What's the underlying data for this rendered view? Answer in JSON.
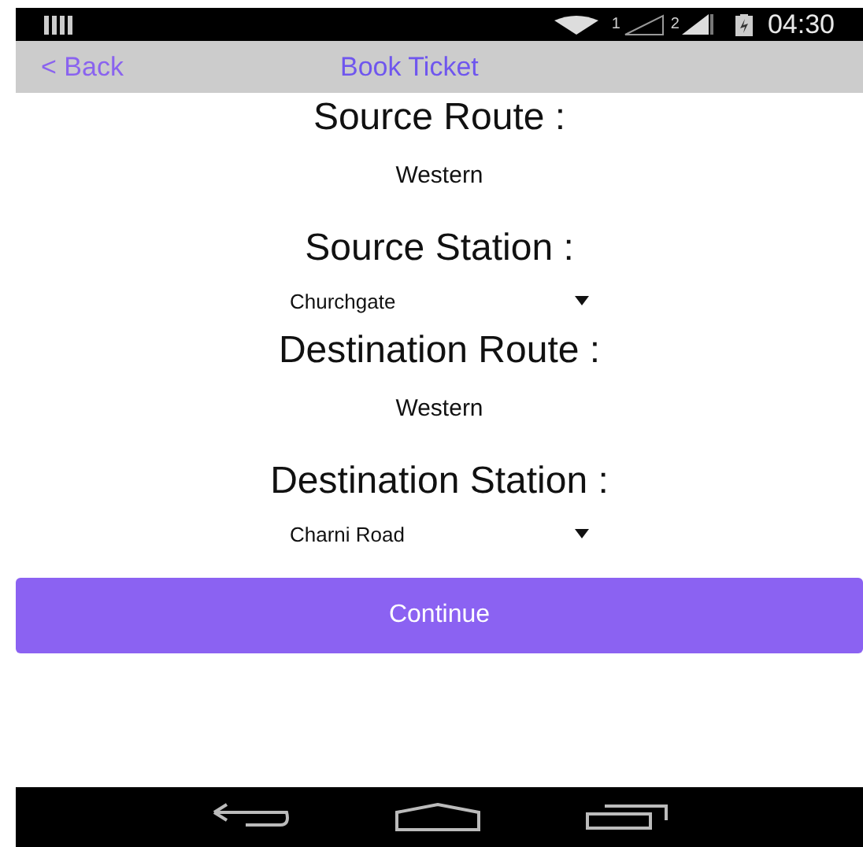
{
  "status_bar": {
    "sim_1": "1",
    "sim_2": "2",
    "time": "04:30"
  },
  "header": {
    "back": "< Back",
    "title": "Book Ticket"
  },
  "fields": [
    {
      "kind": "text",
      "label": "Source Route :",
      "value": "Western"
    },
    {
      "kind": "dropdown",
      "label": "Source Station :",
      "value": "Churchgate"
    },
    {
      "kind": "text",
      "label": "Destination Route :",
      "value": "Western"
    },
    {
      "kind": "dropdown",
      "label": "Destination Station :",
      "value": "Charni Road"
    }
  ],
  "button": "Continue"
}
